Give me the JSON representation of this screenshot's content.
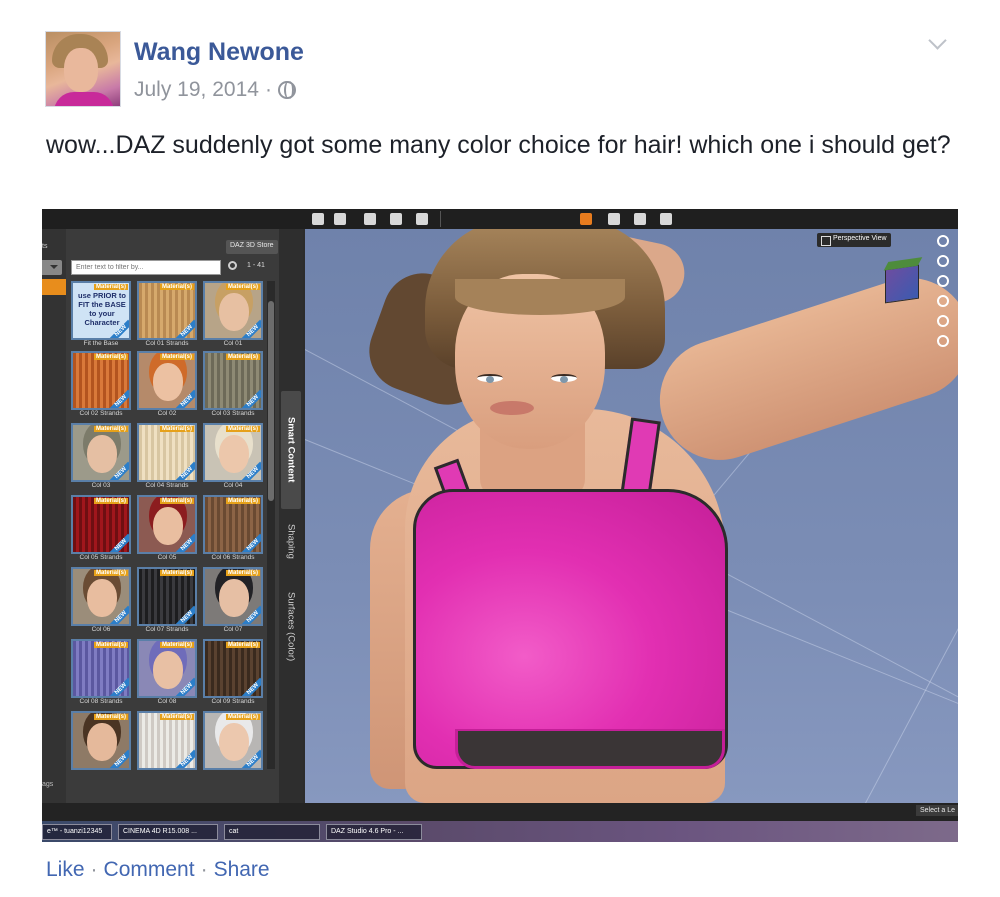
{
  "post": {
    "author": "Wang Newone",
    "date": "July 19, 2014",
    "separator": "·",
    "text": "wow...DAZ suddenly got some many color choice for hair! which one i should get?",
    "audience_icon": "globe-icon",
    "menu_icon": "chevron-down-icon"
  },
  "screenshot": {
    "left_pane": {
      "title": "ts",
      "store_button": "DAZ 3D Store",
      "filter_placeholder": "Enter text to filter by...",
      "range": "1 - 41",
      "bottom_label": "ags",
      "badge": "Material(s)",
      "new_tag": "NEW",
      "thumb_text_1": "use PRIOR to FIT the BASE to your Character",
      "items": [
        {
          "label": "Fit the Base"
        },
        {
          "label": "Col 01 Strands"
        },
        {
          "label": "Col 01"
        },
        {
          "label": "Col 02 Strands"
        },
        {
          "label": "Col 02"
        },
        {
          "label": "Col 03 Strands"
        },
        {
          "label": "Col 03"
        },
        {
          "label": "Col 04 Strands"
        },
        {
          "label": "Col 04"
        },
        {
          "label": "Col 05 Strands"
        },
        {
          "label": "Col 05"
        },
        {
          "label": "Col 06 Strands"
        },
        {
          "label": "Col 06"
        },
        {
          "label": "Col 07 Strands"
        },
        {
          "label": "Col 07"
        },
        {
          "label": "Col 08 Strands"
        },
        {
          "label": "Col 08"
        },
        {
          "label": "Col 09 Strands"
        },
        {
          "label": ""
        },
        {
          "label": ""
        },
        {
          "label": ""
        }
      ]
    },
    "side_tabs": [
      "Smart Content",
      "Shaping",
      "Surfaces (Color)"
    ],
    "viewport": {
      "view_button": "Perspective View"
    },
    "status": {
      "select_label": "Select a Le"
    },
    "taskbar": [
      {
        "label": "e™ - tuanzi12345"
      },
      {
        "label": "CINEMA 4D R15.008 ..."
      },
      {
        "label": "cat"
      },
      {
        "label": "DAZ Studio 4.6 Pro - ..."
      }
    ]
  },
  "actions": {
    "like": "Like",
    "comment": "Comment",
    "share": "Share",
    "separator": "·"
  },
  "colors": {
    "link": "#3b5998",
    "meta": "#90949c",
    "action": "#4267b2",
    "accent_orange": "#e88d1c",
    "bra_pink": "#e22fb2"
  }
}
